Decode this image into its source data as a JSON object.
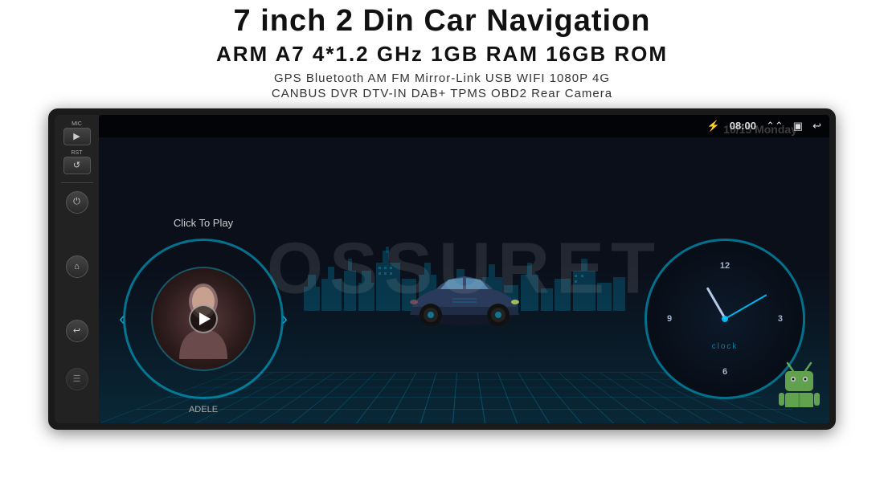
{
  "header": {
    "title": "7 inch 2 Din Car Navigation",
    "specs": "ARM A7 4*1.2 GHz    1GB RAM    16GB ROM",
    "features_line1": "GPS  Bluetooth  AM  FM  Mirror-Link  USB  WIFI  1080P  4G",
    "features_line2": "CANBUS   DVR   DTV-IN   DAB+   TPMS   OBD2   Rear Camera"
  },
  "device": {
    "screen": {
      "status_bar": {
        "bluetooth_icon": "bluetooth",
        "time": "08:00",
        "signal_icon": "signal",
        "window_icon": "window",
        "back_icon": "back"
      },
      "music": {
        "click_to_play": "Click To Play",
        "artist": "ADELE",
        "prev_icon": "‹",
        "next_icon": "›"
      },
      "date_label": "10/15 Monday",
      "clock_label": "clock"
    },
    "left_panel": {
      "mic_label": "MIC",
      "rst_label": "RST",
      "power_icon": "⏻",
      "home_icon": "⌂",
      "back_icon": "↩"
    }
  },
  "watermark": "OSSURET",
  "colors": {
    "accent": "#00c8ff",
    "background": "#0a0f1a",
    "bezel": "#1a1a1a"
  }
}
